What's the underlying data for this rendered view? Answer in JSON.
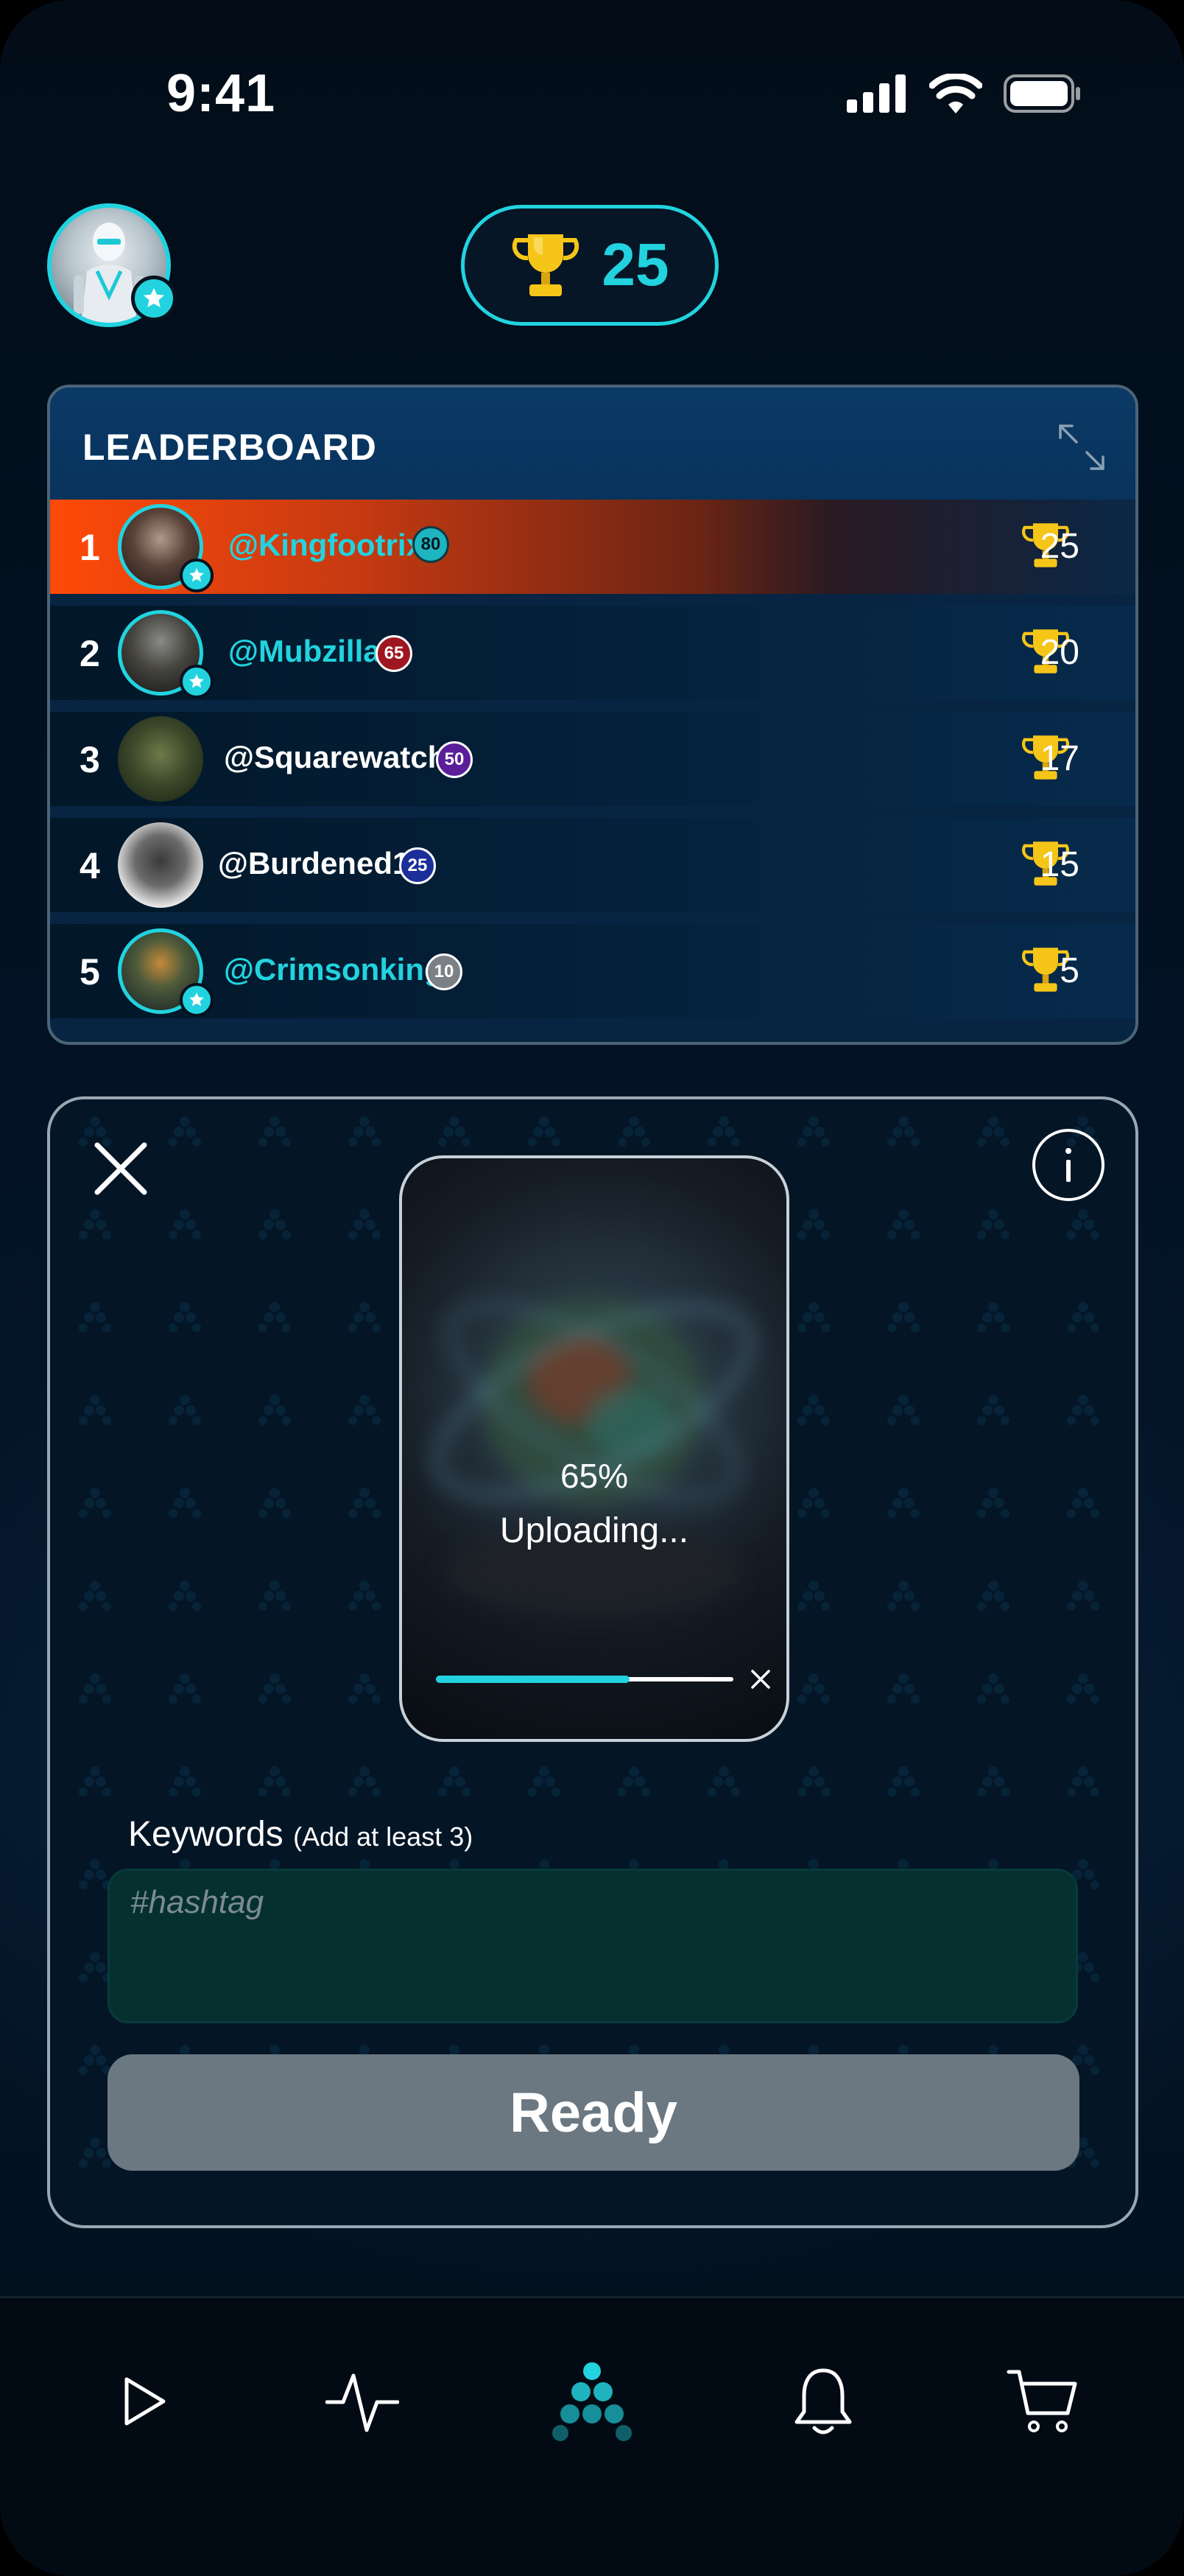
{
  "status_bar": {
    "time": "9:41"
  },
  "header": {
    "trophy_score": "25"
  },
  "leaderboard": {
    "title": "LEADERBOARD",
    "rows": [
      {
        "rank": "1",
        "username": "@Kingfootrix",
        "level": "80",
        "score": "25",
        "badge_color": "#1fb5c0"
      },
      {
        "rank": "2",
        "username": "@Mubzilla",
        "level": "65",
        "score": "20",
        "badge_color": "#a01620"
      },
      {
        "rank": "3",
        "username": "@Squarewatch",
        "level": "50",
        "score": "17",
        "badge_color": "#5b1e9a"
      },
      {
        "rank": "4",
        "username": "@Burdened1",
        "level": "25",
        "score": "15",
        "badge_color": "#1a2f9a"
      },
      {
        "rank": "5",
        "username": "@Crimsonking",
        "level": "10",
        "score": "5",
        "badge_color": "#7b8086"
      }
    ]
  },
  "upload": {
    "progress_fraction": 0.65,
    "percent_label": "65%",
    "status_label": "Uploading...",
    "keywords_label": "Keywords",
    "keywords_hint": "(Add at least 3)",
    "keywords_placeholder": "#hashtag",
    "ready_label": "Ready"
  },
  "tabbar": {
    "icons": [
      "play-icon",
      "activity-icon",
      "home-logo-icon",
      "bell-icon",
      "cart-icon"
    ],
    "active_color": "#22d3df"
  }
}
